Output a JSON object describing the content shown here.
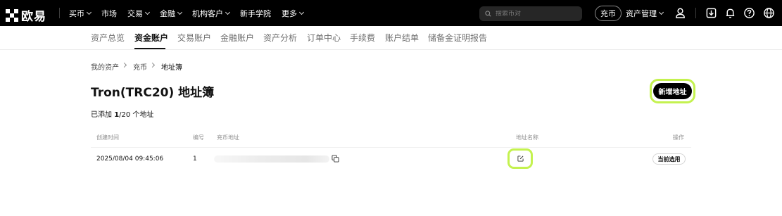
{
  "brand": {
    "logo_text": "欧易",
    "logo_icon": "okx-logo-icon"
  },
  "topnav": {
    "items": [
      {
        "label": "买币",
        "has_dropdown": true
      },
      {
        "label": "市场",
        "has_dropdown": false
      },
      {
        "label": "交易",
        "has_dropdown": true
      },
      {
        "label": "金融",
        "has_dropdown": true
      },
      {
        "label": "机构客户",
        "has_dropdown": true
      },
      {
        "label": "新手学院",
        "has_dropdown": false
      },
      {
        "label": "更多",
        "has_dropdown": true
      }
    ],
    "search_placeholder": "搜索币对",
    "deposit_label": "充币",
    "asset_mgmt_label": "资产管理",
    "right_icons": [
      "user-icon",
      "download-icon",
      "bell-icon",
      "help-icon",
      "globe-icon"
    ]
  },
  "subnav": {
    "tabs": [
      {
        "label": "资产总览",
        "active": false
      },
      {
        "label": "资金账户",
        "active": true
      },
      {
        "label": "交易账户",
        "active": false
      },
      {
        "label": "金融账户",
        "active": false
      },
      {
        "label": "资产分析",
        "active": false
      },
      {
        "label": "订单中心",
        "active": false
      },
      {
        "label": "手续费",
        "active": false
      },
      {
        "label": "账户结单",
        "active": false
      },
      {
        "label": "储备金证明报告",
        "active": false
      }
    ]
  },
  "breadcrumb": [
    "我的资产",
    "充币",
    "地址簿"
  ],
  "page": {
    "title": "Tron(TRC20) 地址簿",
    "count_prefix": "已添加 ",
    "count_value": "1",
    "count_suffix": "/20 个地址",
    "add_button": "新增地址"
  },
  "table": {
    "headers": [
      "创建时间",
      "编号",
      "充币地址",
      "地址名称",
      "操作"
    ],
    "rows": [
      {
        "created": "2025/08/04 09:45:06",
        "index": "1",
        "address": "",
        "name": "",
        "action": "当前选用"
      }
    ]
  },
  "colors": {
    "highlight_ring": "#c4f24f",
    "topbar_bg": "#000000"
  }
}
